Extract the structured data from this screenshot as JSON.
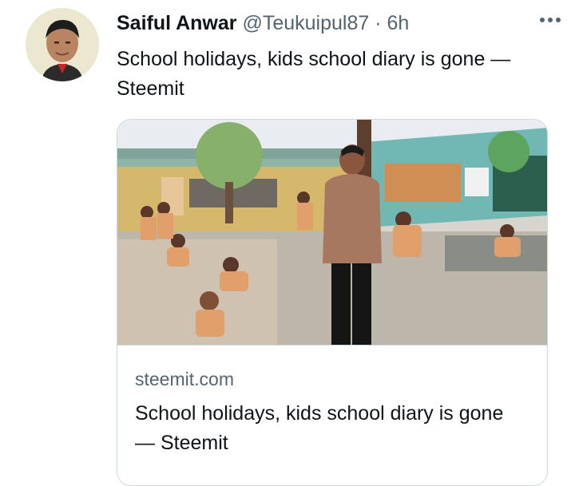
{
  "tweet": {
    "author_name": "Saiful Anwar",
    "author_handle": "@Teukuipul87",
    "separator": "·",
    "time": "6h",
    "more_icon": "more-horizontal-icon",
    "text": "School holidays, kids school diary is gone — Steemit"
  },
  "card": {
    "domain": "steemit.com",
    "title": "School holidays, kids school diary is gone — Steemit"
  },
  "colors": {
    "text_primary": "#0f1419",
    "text_secondary": "#536471",
    "border": "#cfd9de"
  }
}
